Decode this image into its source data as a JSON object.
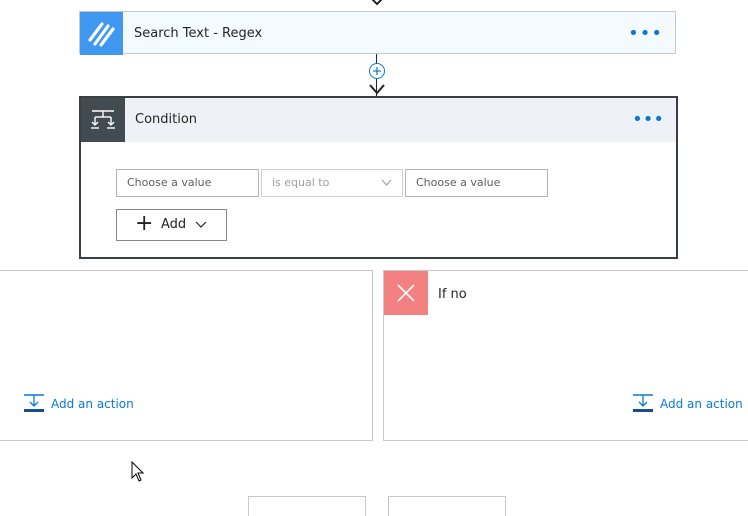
{
  "colors": {
    "search_icon_bg": "#3f97f0",
    "search_card_bg": "#f4fbff",
    "condition_icon_bg": "#424a52",
    "condition_header_bg": "#eef1f5",
    "no_icon_bg": "#f38181",
    "link_blue": "#0a78d7"
  },
  "search_card": {
    "title": "Search Text - Regex",
    "menu": "•••",
    "icon": "striped-logo-icon"
  },
  "connector": {
    "icon": "plus-circle-icon"
  },
  "condition_card": {
    "title": "Condition",
    "menu": "•••",
    "icon": "condition-icon",
    "left_value_placeholder": "Choose a value",
    "operator": "is equal to",
    "right_value_placeholder": "Choose a value",
    "add_label": "Add"
  },
  "branches": {
    "yes": {
      "add_action": "Add an action"
    },
    "no": {
      "label": "If no",
      "add_action": "Add an action"
    }
  }
}
